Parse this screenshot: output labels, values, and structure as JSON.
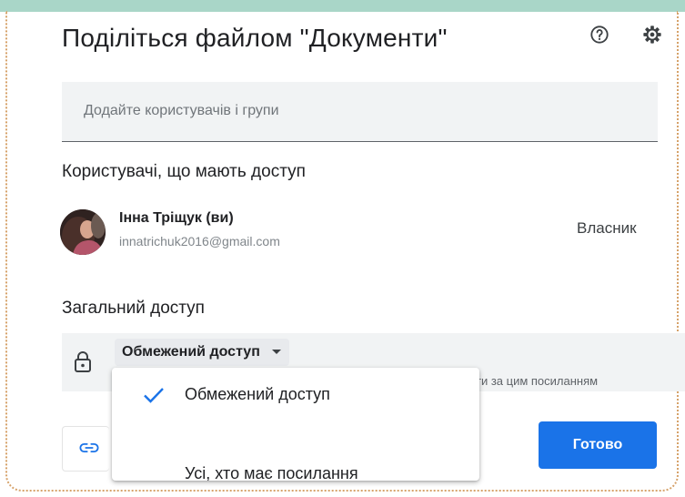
{
  "dialog": {
    "title": "Поділіться файлом \"Документи\"",
    "add_placeholder": "Додайте користувачів і групи",
    "access_heading": "Користувачі, що мають доступ",
    "user": {
      "name": "Інна Тріщук (ви)",
      "email": "innatrichuk2016@gmail.com",
      "role": "Власник"
    },
    "general_heading": "Загальний доступ",
    "access": {
      "selected": "Обмежений доступ",
      "description": "ти за цим посиланням"
    },
    "done_label": "Готово"
  },
  "menu": {
    "items": [
      {
        "label": "Обмежений доступ",
        "checked": true
      },
      {
        "label": "Усі, хто має посилання",
        "checked": false
      }
    ]
  },
  "colors": {
    "accent": "#1a73e8",
    "top_band": "#a9d6c8",
    "frame_border": "#d6a26a"
  },
  "icons": [
    "help-icon",
    "settings-gear-icon",
    "lock-icon",
    "dropdown-caret-icon",
    "checkmark-icon",
    "link-icon"
  ]
}
